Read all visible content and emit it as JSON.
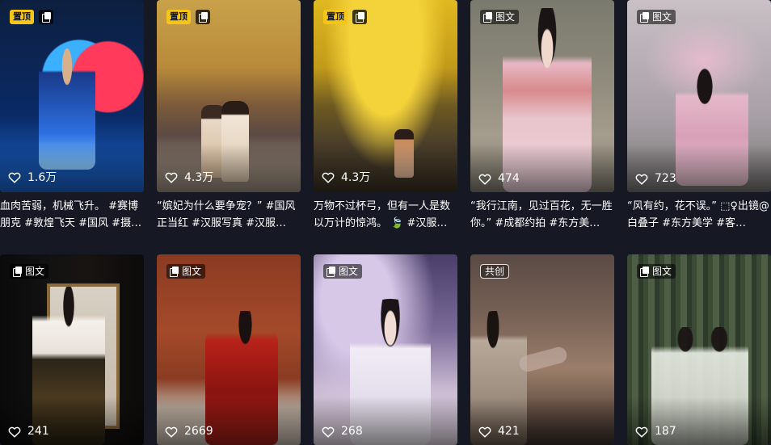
{
  "badges": {
    "pinned": "置顶",
    "image_text": "图文",
    "co_create": "共创"
  },
  "row1": [
    {
      "likes": "1.6万",
      "desc": "血肉苦弱，机械飞升。 #赛博朋克 #敦煌飞天 #国风 #摄…"
    },
    {
      "likes": "4.3万",
      "desc": "“嫔妃为什么要争宠？” #国风正当红 #汉服写真 #汉服…"
    },
    {
      "likes": "4.3万",
      "desc": "万物不过杯弓，但有一人是数以万计的惊鸿。 🍃 #汉服写…"
    },
    {
      "likes": "474",
      "desc": "“我行江南，见过百花，无一胜你。” #成都约拍 #东方美…"
    },
    {
      "likes": "723",
      "desc": "“风有约，花不误。” ⬚♀出镜@白叠子 #东方美学 #客…"
    }
  ],
  "row2": [
    {
      "likes": "241"
    },
    {
      "likes": "2669"
    },
    {
      "likes": "268"
    },
    {
      "likes": "421"
    },
    {
      "likes": "187"
    }
  ],
  "colors": {
    "background": "#161823",
    "pinned_badge": "#f5c518"
  }
}
